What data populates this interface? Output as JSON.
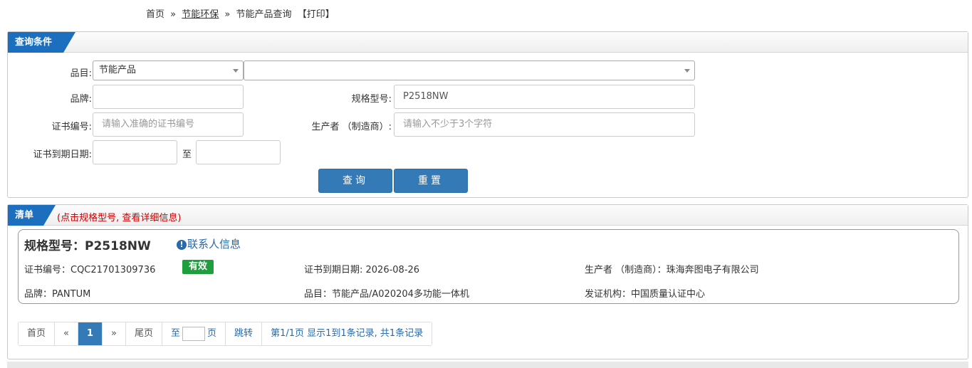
{
  "breadcrumb": {
    "home": "首页",
    "sep1": "»",
    "section": "节能环保",
    "sep2": "»",
    "current": "节能产品查询",
    "print": "【打印】"
  },
  "query_panel": {
    "title": "查询条件",
    "category_label": "品目:",
    "category_value": "节能产品",
    "subcategory_value": "",
    "brand_label": "品牌:",
    "brand_value": "",
    "model_label": "规格型号:",
    "model_value": "P2518NW",
    "cert_no_label": "证书编号:",
    "cert_no_placeholder": "请输入准确的证书编号",
    "producer_label": "生产者 （制造商）:",
    "producer_placeholder": "请输入不少于3个字符",
    "expiry_label": "证书到期日期:",
    "expiry_to": "至",
    "search_button": "查询",
    "reset_button": "重置"
  },
  "list_panel": {
    "title": "清单",
    "hint": "(点击规格型号, 查看详细信息)",
    "result": {
      "model_title": "规格型号：P2518NW",
      "contact_icon": "info-circle-icon",
      "contact_link": "联系人信息",
      "cert_no": "证书编号：CQC21701309736",
      "status": "有效",
      "expiry": "证书到期日期: 2026-08-26",
      "producer": "生产者 （制造商）：珠海奔图电子有限公司",
      "brand": "品牌：PANTUM",
      "category": "品目：节能产品/A020204多功能一体机",
      "issuer": "发证机构：中国质量认证中心"
    },
    "pager": {
      "first": "首页",
      "prev": "«",
      "page": "1",
      "next": "»",
      "last": "尾页",
      "goto_prefix": "至",
      "goto_suffix": "页",
      "jump": "跳转",
      "summary": "第1/1页  显示1到1条记录, 共1条记录"
    }
  },
  "colors": {
    "accent": "#1b6fbe",
    "button": "#337ab7",
    "status_valid": "#1e9e3c",
    "hint_red": "#cc0000"
  }
}
